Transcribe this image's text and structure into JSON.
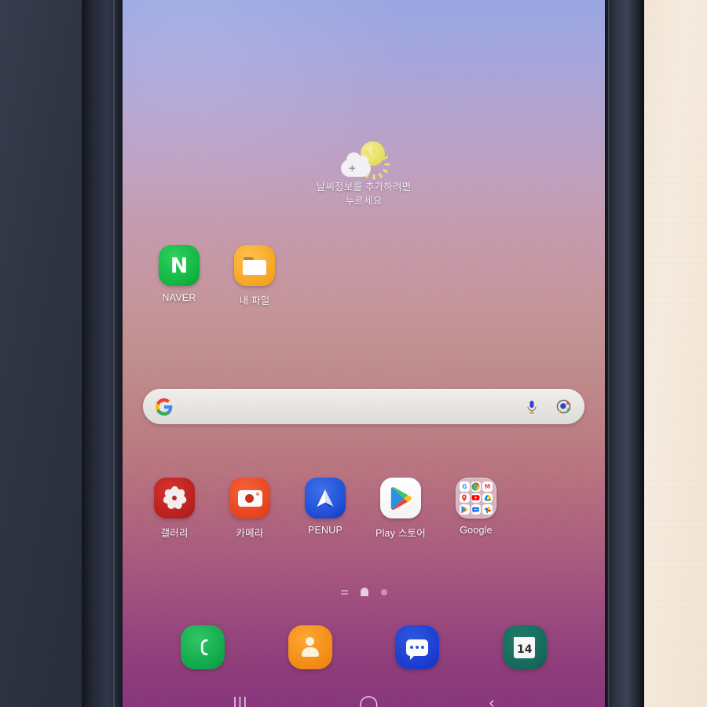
{
  "device": {
    "type": "android-tablet-home-screen",
    "frame": {
      "bezel_color": "#242a36",
      "left_background": "#2e3343",
      "right_background": "#f3e6d6"
    }
  },
  "wallpaper": {
    "description": "vertical gradient wallpaper",
    "top_color": "#98a6e2",
    "mid_color": "#c08e8e",
    "bottom_color": "#8b3a7a"
  },
  "weather_widget": {
    "icon": "sun-behind-cloud-add-icon",
    "line1": "날씨정보를 추가하려면",
    "line2": "누르세요"
  },
  "home_rows": [
    {
      "name": "row-1",
      "apps": [
        {
          "label": "NAVER",
          "icon": "naver-icon",
          "glyph": "N",
          "color": "#10b43f"
        },
        {
          "label": "내 파일",
          "icon": "my-files-folder-icon",
          "color": "#f5a623"
        }
      ]
    },
    {
      "name": "row-2",
      "apps": [
        {
          "label": "갤러리",
          "icon": "gallery-flower-icon",
          "color": "#b8201d"
        },
        {
          "label": "카메라",
          "icon": "camera-icon",
          "color": "#e8441f"
        },
        {
          "label": "PENUP",
          "icon": "penup-pen-nib-icon",
          "color": "#1f4fd8"
        },
        {
          "label": "Play 스토어",
          "icon": "play-store-icon",
          "color": "#ffffff"
        },
        {
          "label": "Google",
          "icon": "google-folder-icon",
          "color": "#eee8ea"
        }
      ]
    }
  ],
  "google_folder": {
    "label": "Google",
    "apps": [
      {
        "name": "google-search-icon",
        "glyph": "G",
        "color": "#ffffff",
        "fg": "#4285f4"
      },
      {
        "name": "chrome-icon",
        "glyph": "",
        "color": "#ffffff",
        "fg": "#1a73e8"
      },
      {
        "name": "gmail-icon",
        "glyph": "M",
        "color": "#ffffff",
        "fg": "#ea4335"
      },
      {
        "name": "maps-icon",
        "glyph": "",
        "color": "#ffffff",
        "fg": "#34a853"
      },
      {
        "name": "youtube-icon",
        "glyph": "",
        "color": "#ff0000",
        "fg": "#ffffff"
      },
      {
        "name": "drive-icon",
        "glyph": "",
        "color": "#ffffff",
        "fg": "#fbbc04"
      },
      {
        "name": "play-store-mini-icon",
        "glyph": "",
        "color": "#ffffff",
        "fg": "#34a853"
      },
      {
        "name": "messages-mini-icon",
        "glyph": "",
        "color": "#ffffff",
        "fg": "#1a73e8"
      },
      {
        "name": "photos-icon",
        "glyph": "",
        "color": "#ffffff",
        "fg": "#34a853"
      }
    ]
  },
  "search_bar": {
    "logo": "google-g-icon",
    "value": "",
    "placeholder": "",
    "mic_icon": "microphone-icon",
    "lens_icon": "google-lens-icon"
  },
  "page_indicator": {
    "items": [
      {
        "name": "page-dot-apps",
        "type": "dash",
        "active": false
      },
      {
        "name": "page-dot-home",
        "type": "home",
        "active": true
      },
      {
        "name": "page-dot-2",
        "type": "dot",
        "active": false
      }
    ]
  },
  "dock": {
    "items": [
      {
        "name": "phone-app",
        "icon": "phone-handset-icon",
        "color": "#11a84b"
      },
      {
        "name": "contacts-app",
        "icon": "contacts-person-icon",
        "color": "#f18a16"
      },
      {
        "name": "messages-app",
        "icon": "message-bubble-icon",
        "color": "#1a3bcf"
      },
      {
        "name": "calendar-app",
        "icon": "calendar-icon",
        "day": "14",
        "color": "#16695a"
      }
    ]
  },
  "nav_bar": {
    "recents_glyph": "|||",
    "home_glyph": "◯",
    "back_glyph": "‹"
  }
}
